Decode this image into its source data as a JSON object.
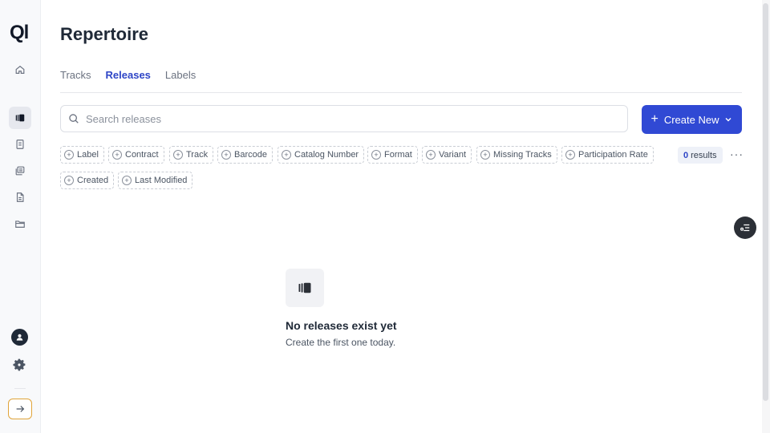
{
  "sidebar": {
    "logo": "Ql",
    "items": [
      {
        "icon": "home-icon"
      },
      {
        "icon": "releases-icon",
        "active": true
      },
      {
        "icon": "document-icon"
      },
      {
        "icon": "stack-icon"
      },
      {
        "icon": "file-icon"
      },
      {
        "icon": "folder-icon"
      }
    ],
    "bottom": {
      "avatar": "user-avatar",
      "settings": "gear-icon",
      "expand": "arrow-right-icon"
    }
  },
  "page": {
    "title": "Repertoire",
    "tabs": [
      {
        "label": "Tracks",
        "active": false
      },
      {
        "label": "Releases",
        "active": true
      },
      {
        "label": "Labels",
        "active": false
      }
    ]
  },
  "search": {
    "placeholder": "Search releases",
    "value": ""
  },
  "create_button": {
    "label": "Create New"
  },
  "filters": [
    "Label",
    "Contract",
    "Track",
    "Barcode",
    "Catalog Number",
    "Format",
    "Variant",
    "Missing Tracks",
    "Participation Rate",
    "Created",
    "Last Modified"
  ],
  "results": {
    "count": "0",
    "label": "results"
  },
  "empty_state": {
    "title": "No releases exist yet",
    "subtitle": "Create the first one today."
  },
  "colors": {
    "accent": "#3049d4",
    "tab_active": "#2e45c6",
    "expand_border": "#e0a43a"
  }
}
